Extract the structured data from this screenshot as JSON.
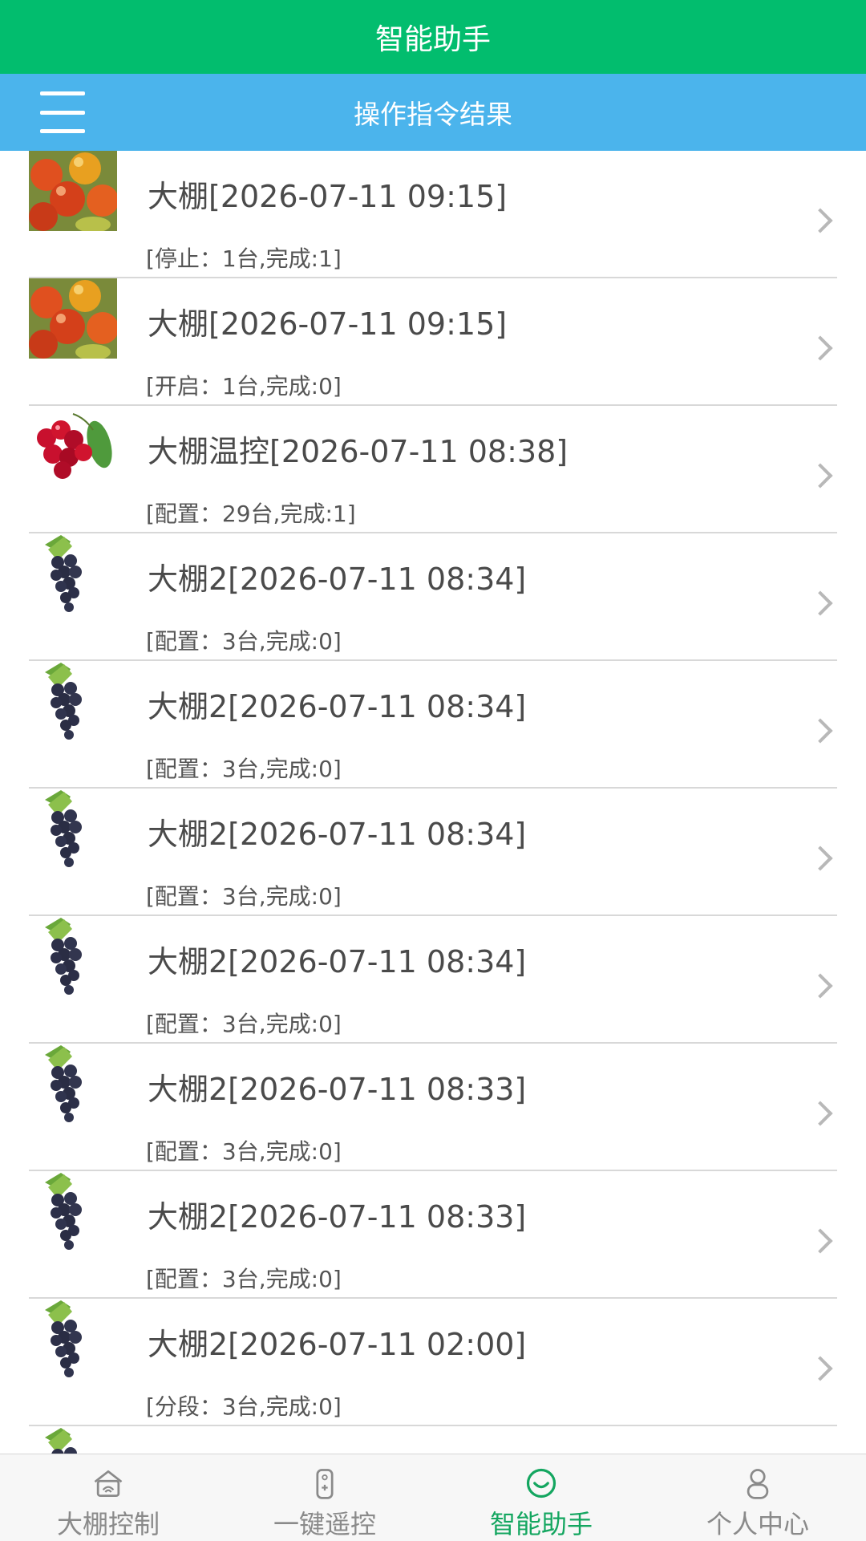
{
  "app": {
    "title": "智能助手"
  },
  "header": {
    "title": "操作指令结果",
    "menu_icon": "hamburger-menu-icon"
  },
  "colors": {
    "appbar": "#02bd6e",
    "subbar": "#4bb4ec",
    "active_tab": "#14a660"
  },
  "list": {
    "items": [
      {
        "title": "大棚[2026-07-11 09:15]",
        "detail": "[停止：1台,完成:1]",
        "thumb": "jujube"
      },
      {
        "title": "大棚[2026-07-11 09:15]",
        "detail": "[开启：1台,完成:0]",
        "thumb": "jujube"
      },
      {
        "title": "大棚温控[2026-07-11 08:38]",
        "detail": "[配置：29台,完成:1]",
        "thumb": "cherry"
      },
      {
        "title": "大棚2[2026-07-11 08:34]",
        "detail": "[配置：3台,完成:0]",
        "thumb": "grape"
      },
      {
        "title": "大棚2[2026-07-11 08:34]",
        "detail": "[配置：3台,完成:0]",
        "thumb": "grape"
      },
      {
        "title": "大棚2[2026-07-11 08:34]",
        "detail": "[配置：3台,完成:0]",
        "thumb": "grape"
      },
      {
        "title": "大棚2[2026-07-11 08:34]",
        "detail": "[配置：3台,完成:0]",
        "thumb": "grape"
      },
      {
        "title": "大棚2[2026-07-11 08:33]",
        "detail": "[配置：3台,完成:0]",
        "thumb": "grape"
      },
      {
        "title": "大棚2[2026-07-11 08:33]",
        "detail": "[配置：3台,完成:0]",
        "thumb": "grape"
      },
      {
        "title": "大棚2[2026-07-11 02:00]",
        "detail": "[分段：3台,完成:0]",
        "thumb": "grape"
      },
      {
        "title": "",
        "detail": "",
        "thumb": "grape"
      }
    ]
  },
  "tabbar": {
    "tabs": [
      {
        "label": "大棚控制",
        "icon": "greenhouse-icon",
        "active": false
      },
      {
        "label": "一键遥控",
        "icon": "remote-control-icon",
        "active": false
      },
      {
        "label": "智能助手",
        "icon": "assistant-smile-icon",
        "active": true
      },
      {
        "label": "个人中心",
        "icon": "person-icon",
        "active": false
      }
    ]
  }
}
